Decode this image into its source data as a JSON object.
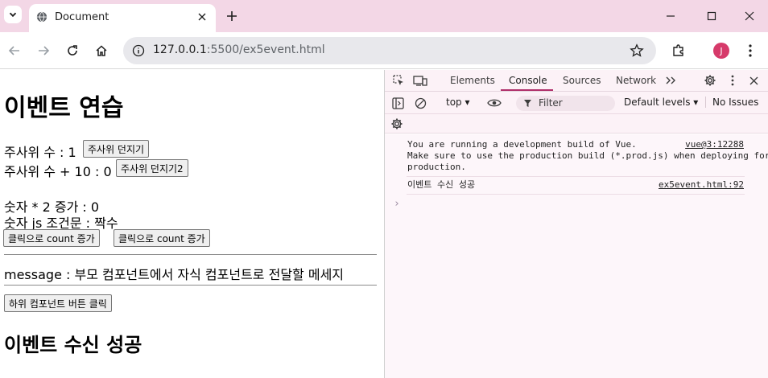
{
  "browser": {
    "tab_title": "Document",
    "url_host": "127.0.0.1",
    "url_rest": ":5500/ex5event.html",
    "profile_initial": "J",
    "accent_color": "#f3d7e6"
  },
  "page": {
    "title": "이벤트 연습",
    "dice_label": "주사위 수 : 1",
    "dice_button": "주사위 던지기",
    "dice_plus_label": "주사위 수 + 10 : 0",
    "dice_plus_button": "주사위 던지기2",
    "double_label": "숫자 * 2 증가 : 0",
    "parity_label": "숫자 js 조건문 : 짝수",
    "count_button_1": "클릭으로 count 증가",
    "count_button_2": "클릭으로 count 증가",
    "message_label": "message : 부모 컴포넌트에서 자식 컴포넌트로 전달할 메세지",
    "child_button": "하위 컴포넌트 버튼 클릭",
    "result_heading": "이벤트 수신 성공"
  },
  "devtools": {
    "tabs": [
      "Elements",
      "Console",
      "Sources",
      "Network"
    ],
    "active_tab": "Console",
    "context": "top",
    "filter_placeholder": "Filter",
    "levels": "Default levels",
    "issues": "No Issues",
    "messages": [
      {
        "text": "You are running a development build of Vue.\nMake sure to use the production build (*.prod.js) when deploying for\nproduction.",
        "source": "vue@3:12288"
      },
      {
        "text": "이벤트 수신 성공",
        "source": "ex5event.html:92"
      }
    ],
    "prompt": "›"
  }
}
